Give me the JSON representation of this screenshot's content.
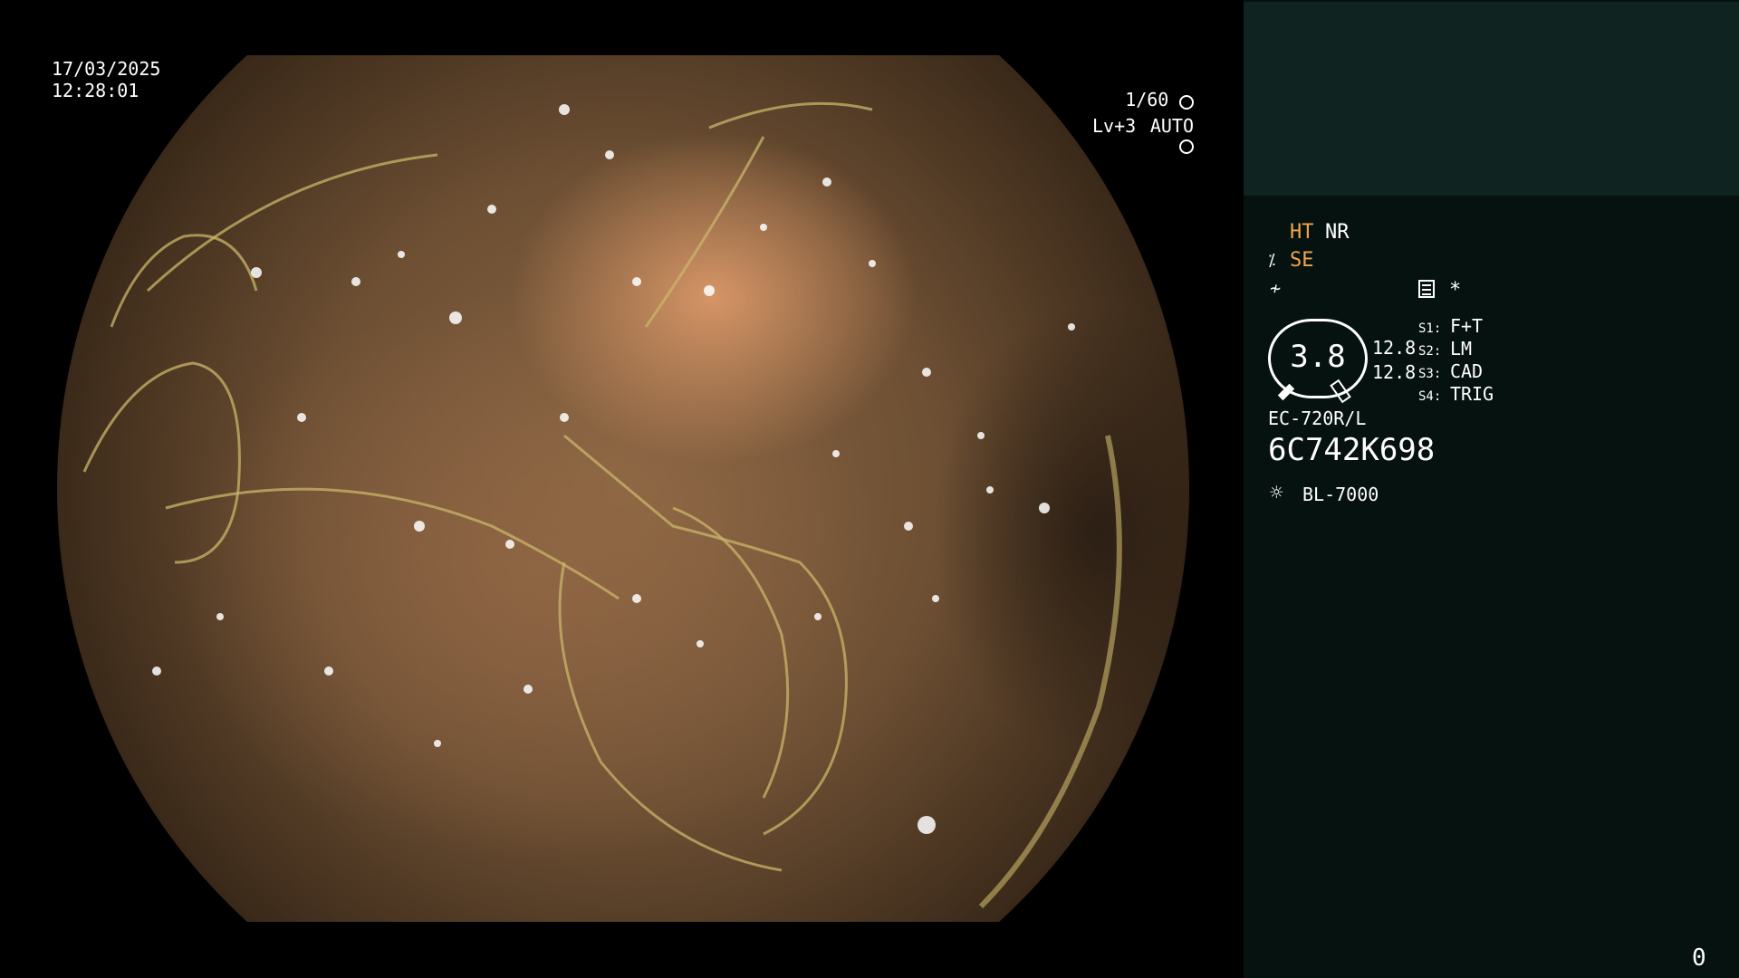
{
  "overlay": {
    "date": "17/03/2025",
    "time": "12:28:01",
    "shutter": "1/60",
    "level": "Lv+3",
    "iris": "AUTO"
  },
  "panel": {
    "mode_ht": "HT",
    "mode_nr": "NR",
    "mode_se": "SE",
    "star": "*",
    "gauge_value": "3.8",
    "gauge_side_top": "12.8",
    "gauge_side_bottom": "12.8",
    "switches": [
      {
        "key": "S1",
        "value": "F+T"
      },
      {
        "key": "S2",
        "value": "LM"
      },
      {
        "key": "S3",
        "value": "CAD"
      },
      {
        "key": "S4",
        "value": "TRIG"
      }
    ],
    "scope_model": "EC-720R/L",
    "serial": "6C742K698",
    "light_source": "BL-7000",
    "counter": "0"
  },
  "colors": {
    "panel_bg": "#061210",
    "panel_top_bg": "#0f2320",
    "accent_orange": "#f0a64a"
  }
}
